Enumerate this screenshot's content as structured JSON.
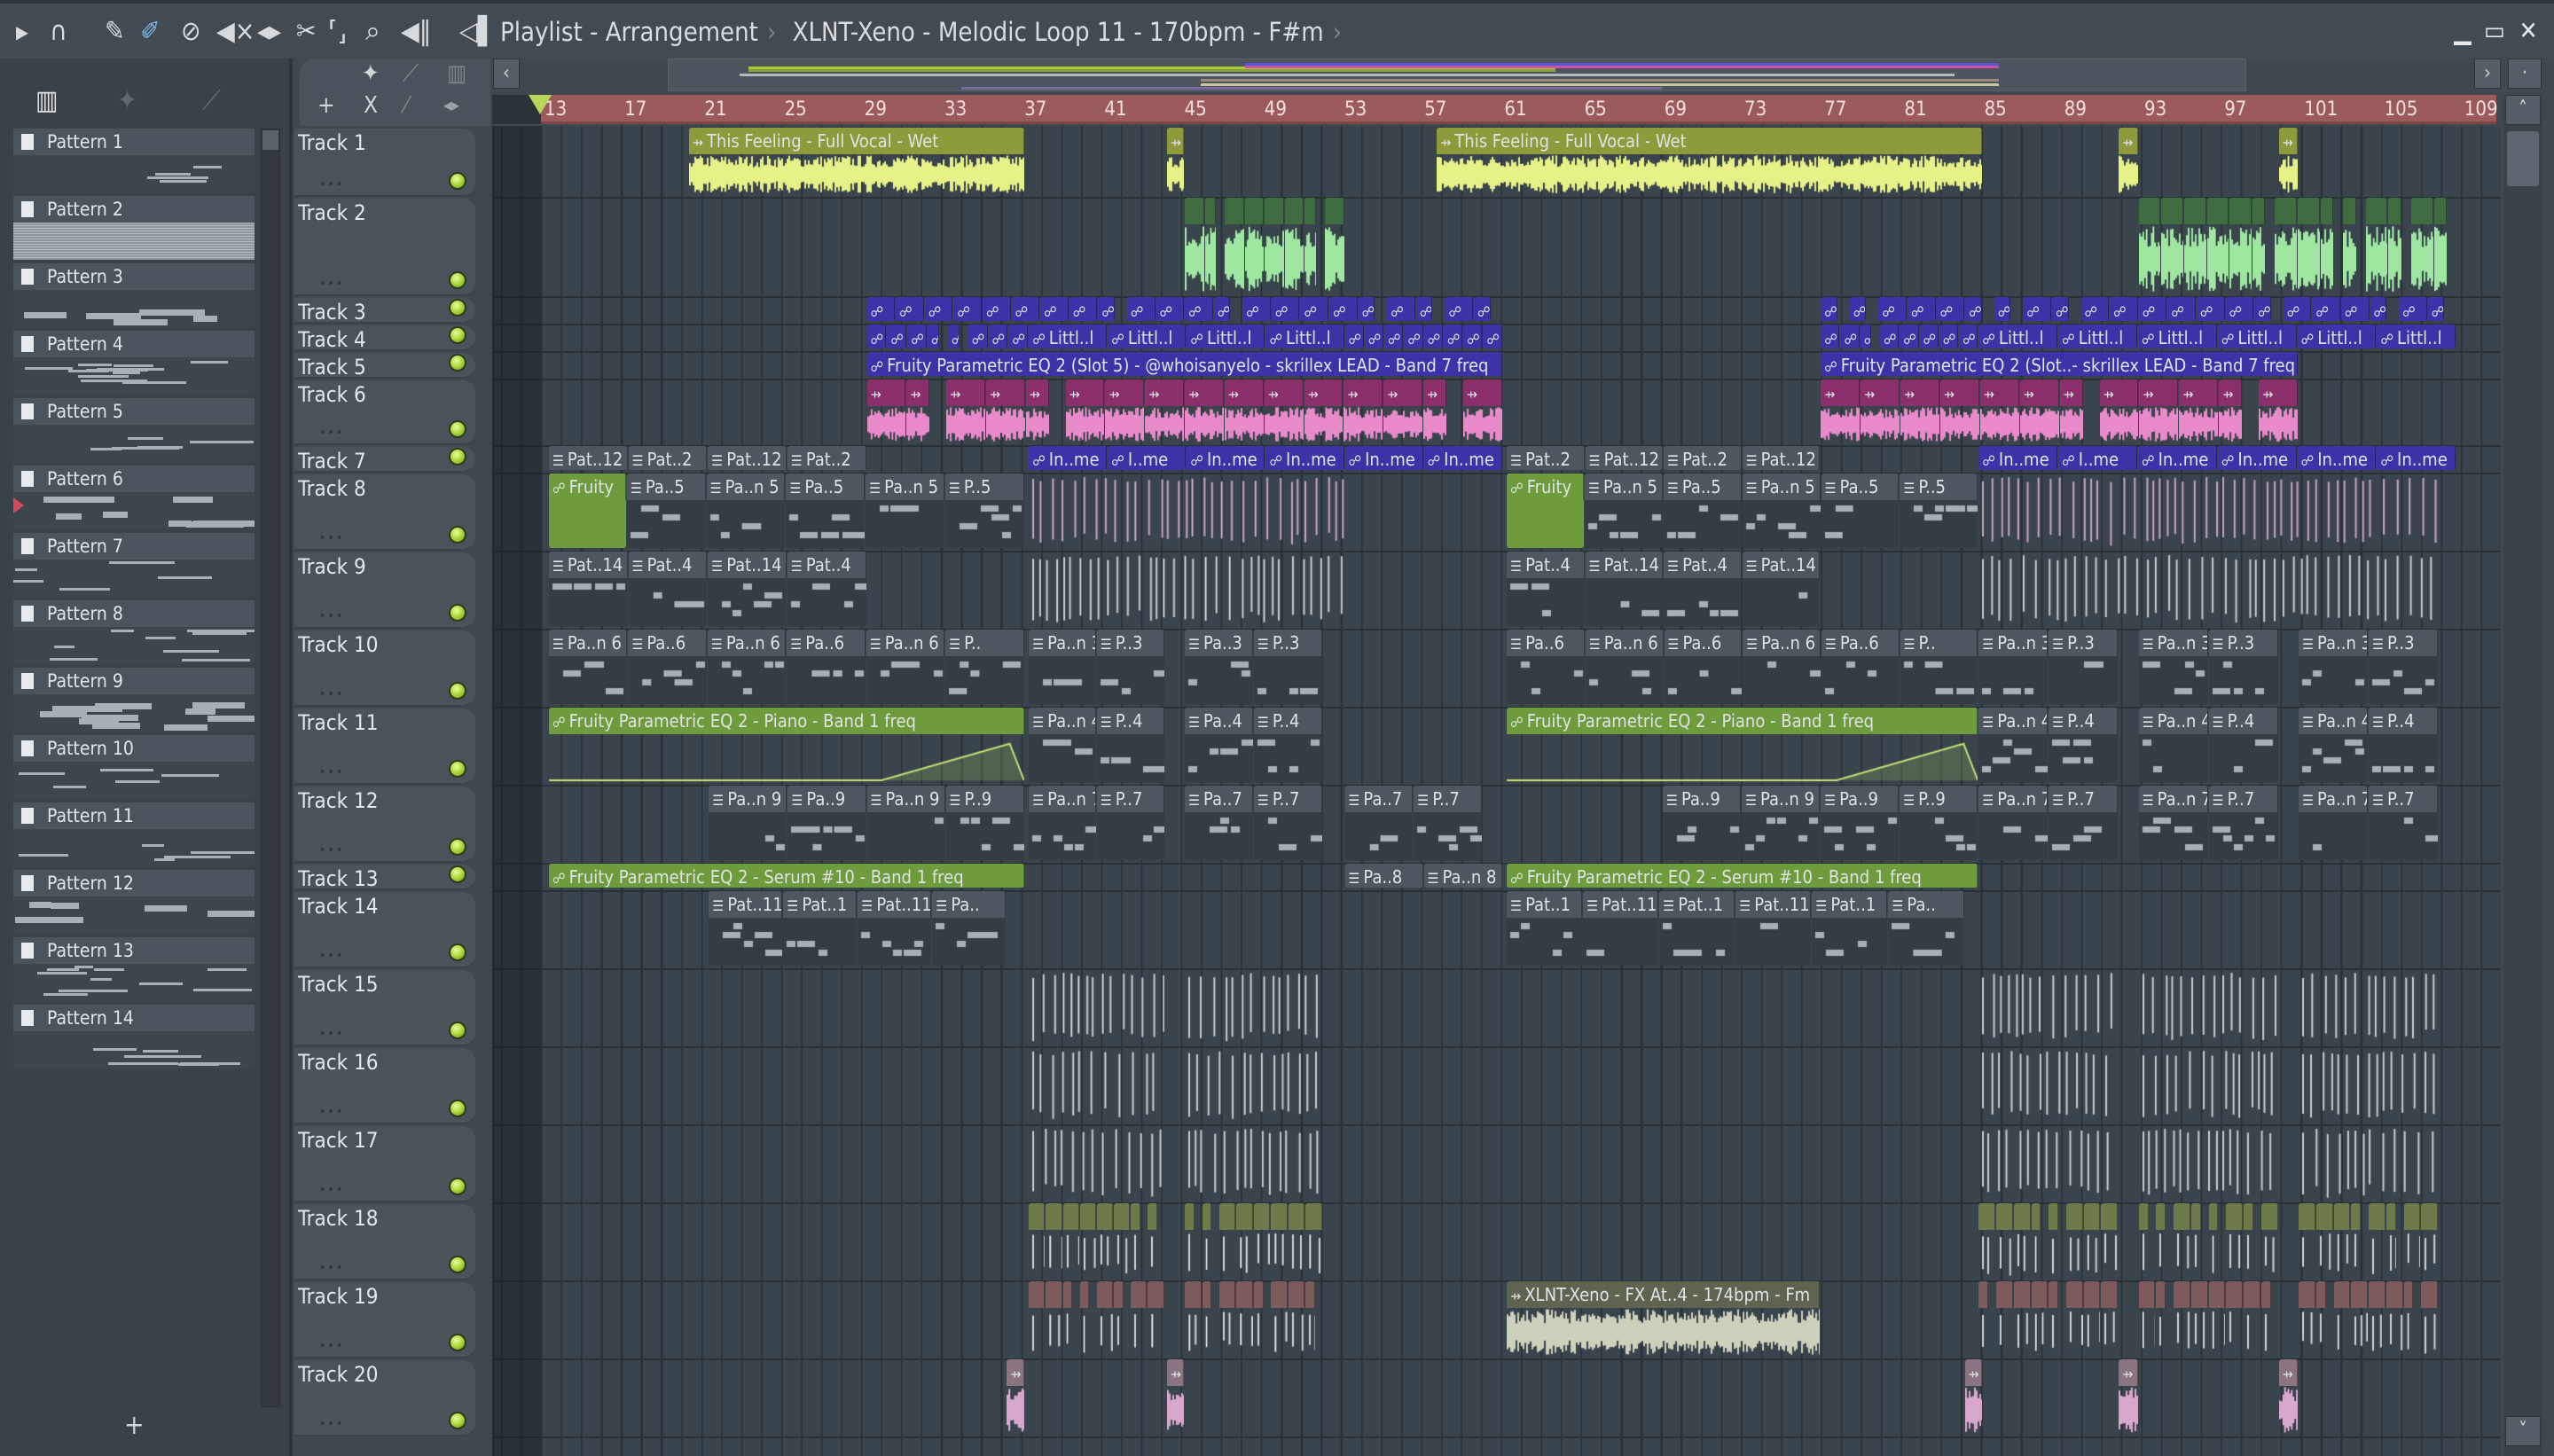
{
  "toolbar": {
    "icons": [
      "play-arrow",
      "magnet",
      "pencil",
      "paint-brush",
      "delete",
      "mute",
      "slip",
      "slice",
      "select",
      "zoom",
      "playback"
    ],
    "title_parts": [
      "Playlist - Arrangement",
      "XLNT-Xeno - Melodic Loop 11 - 170bpm - F#m"
    ]
  },
  "patterns": [
    "Pattern 1",
    "Pattern 2",
    "Pattern 3",
    "Pattern 4",
    "Pattern 5",
    "Pattern 6",
    "Pattern 7",
    "Pattern 8",
    "Pattern 9",
    "Pattern 10",
    "Pattern 11",
    "Pattern 12",
    "Pattern 13",
    "Pattern 14"
  ],
  "add_label": "+",
  "ruler": {
    "bars": [
      "13",
      "17",
      "21",
      "25",
      "29",
      "33",
      "37",
      "41",
      "45",
      "49",
      "53",
      "57",
      "61",
      "65",
      "69",
      "73",
      "77",
      "81",
      "85",
      "89",
      "93",
      "97",
      "101",
      "105",
      "109"
    ]
  },
  "tracks": [
    "Track 1",
    "Track 2",
    "Track 3",
    "Track 4",
    "Track 5",
    "Track 6",
    "Track 7",
    "Track 8",
    "Track 9",
    "Track 10",
    "Track 11",
    "Track 12",
    "Track 13",
    "Track 14",
    "Track 15",
    "Track 16",
    "Track 17",
    "Track 18",
    "Track 19",
    "Track 20"
  ],
  "colors": {
    "ruler": "#9b5a5c",
    "accent": "#b6d85a",
    "brush": "#7ab8ee"
  },
  "clips": [
    {
      "track": 1,
      "start": 20.4,
      "end": 37.2,
      "type": "yellow",
      "labels": [
        "This Feeling - Full Vocal - Wet"
      ]
    },
    {
      "track": 1,
      "start": 44.3,
      "end": 45.2,
      "type": "yellow",
      "labels": []
    },
    {
      "track": 1,
      "start": 57.8,
      "end": 85.1,
      "type": "yellow",
      "labels": [
        "This Feeling - Full Vocal - Wet"
      ]
    },
    {
      "track": 1,
      "start": 91.9,
      "end": 92.9,
      "type": "yellow",
      "labels": []
    },
    {
      "track": 1,
      "start": 99.9,
      "end": 100.9,
      "type": "yellow",
      "labels": []
    },
    {
      "track": 2,
      "start": 45.2,
      "end": 53.2,
      "type": "green",
      "labels": [],
      "segments": 8
    },
    {
      "track": 2,
      "start": 92.9,
      "end": 108.8,
      "type": "green",
      "labels": [],
      "segments": 14
    },
    {
      "track": 3,
      "start": 29.3,
      "end": 61.1,
      "type": "purple",
      "labels": [],
      "segments": 22
    },
    {
      "track": 3,
      "start": 77,
      "end": 108.8,
      "type": "purple",
      "labels": [],
      "segments": 22
    },
    {
      "track": 4,
      "start": 29.3,
      "end": 37.4,
      "type": "purple",
      "labels": [],
      "segments": 8
    },
    {
      "track": 4,
      "start": 37.4,
      "end": 53.2,
      "type": "purple",
      "labels": [
        "Littl..l",
        "Littl..l",
        "Littl..l",
        "Littl..l"
      ]
    },
    {
      "track": 4,
      "start": 53.2,
      "end": 61.1,
      "type": "purple",
      "labels": [],
      "segments": 8
    },
    {
      "track": 4,
      "start": 77,
      "end": 84.9,
      "type": "purple",
      "labels": [],
      "segments": 8
    },
    {
      "track": 4,
      "start": 84.9,
      "end": 108.8,
      "type": "purple",
      "labels": [
        "Littl..l",
        "Littl..l",
        "Littl..l",
        "Littl..l",
        "Littl..l",
        "Littl..l"
      ]
    },
    {
      "track": 5,
      "start": 29.3,
      "end": 61.1,
      "type": "purple-auto",
      "labels": [
        "Fruity Parametric EQ 2 (Slot 5) - @whoisanyelo - skrillex LEAD - Band 7 freq"
      ]
    },
    {
      "track": 5,
      "start": 77,
      "end": 100.9,
      "type": "purple-auto",
      "labels": [
        "Fruity Parametric EQ 2 (Slot..- skrillex LEAD - Band 7 freq"
      ]
    },
    {
      "track": 6,
      "start": 29.3,
      "end": 61.1,
      "type": "pink",
      "labels": [],
      "segments": 16
    },
    {
      "track": 6,
      "start": 77,
      "end": 100.9,
      "type": "pink",
      "labels": [],
      "segments": 12
    },
    {
      "track": 7,
      "start": 13.4,
      "end": 29.3,
      "type": "pattern",
      "labels": [
        "Pat..12",
        "Pat..2",
        "Pat..12",
        "Pat..2"
      ]
    },
    {
      "track": 7,
      "start": 37.4,
      "end": 61.1,
      "type": "purple-auto",
      "labels": [
        "In..me",
        "I..me",
        "In..me",
        "In..me",
        "In..me",
        "In..me"
      ]
    },
    {
      "track": 7,
      "start": 61.3,
      "end": 77,
      "type": "pattern",
      "labels": [
        "Pat..2",
        "Pat..12",
        "Pat..2",
        "Pat..12"
      ]
    },
    {
      "track": 7,
      "start": 84.9,
      "end": 108.8,
      "type": "purple-auto",
      "labels": [
        "In..me",
        "I..me",
        "In..me",
        "In..me",
        "In..me",
        "In..me"
      ]
    },
    {
      "track": 8,
      "start": 13.4,
      "end": 17.3,
      "type": "auto",
      "labels": [
        "Fruity"
      ]
    },
    {
      "track": 8,
      "start": 17.3,
      "end": 37.2,
      "type": "pattern",
      "labels": [
        "Pa..5",
        "Pa..n 5",
        "Pa..5",
        "Pa..n 5",
        "P..5"
      ]
    },
    {
      "track": 8,
      "start": 37.4,
      "end": 53.2,
      "type": "lines-pink",
      "labels": []
    },
    {
      "track": 8,
      "start": 61.3,
      "end": 65.2,
      "type": "auto",
      "labels": [
        "Fruity"
      ]
    },
    {
      "track": 8,
      "start": 65.2,
      "end": 84.9,
      "type": "pattern",
      "labels": [
        "Pa..n 5",
        "Pa..5",
        "Pa..n 5",
        "Pa..5",
        "P..5"
      ]
    },
    {
      "track": 8,
      "start": 84.9,
      "end": 107.9,
      "type": "lines-pink",
      "labels": []
    },
    {
      "track": 9,
      "start": 13.4,
      "end": 29.3,
      "type": "pattern",
      "labels": [
        "Pat..14",
        "Pat..4",
        "Pat..14",
        "Pat..4"
      ]
    },
    {
      "track": 9,
      "start": 37.4,
      "end": 53.2,
      "type": "lines",
      "labels": []
    },
    {
      "track": 9,
      "start": 61.3,
      "end": 77,
      "type": "pattern",
      "labels": [
        "Pat..4",
        "Pat..14",
        "Pat..4",
        "Pat..14"
      ]
    },
    {
      "track": 9,
      "start": 84.9,
      "end": 107.9,
      "type": "lines",
      "labels": []
    },
    {
      "track": 10,
      "start": 13.4,
      "end": 37.2,
      "type": "pattern",
      "labels": [
        "Pa..n 6",
        "Pa..6",
        "Pa..n 6",
        "Pa..6",
        "Pa..n 6",
        "P.."
      ]
    },
    {
      "track": 10,
      "start": 37.4,
      "end": 44.2,
      "type": "pattern",
      "labels": [
        "Pa..n 3",
        "P..3"
      ]
    },
    {
      "track": 10,
      "start": 45.2,
      "end": 52.1,
      "type": "pattern",
      "labels": [
        "Pa..3",
        "P..3"
      ]
    },
    {
      "track": 10,
      "start": 61.3,
      "end": 84.9,
      "type": "pattern",
      "labels": [
        "Pa..6",
        "Pa..n 6",
        "Pa..6",
        "Pa..n 6",
        "Pa..6",
        "P.."
      ]
    },
    {
      "track": 10,
      "start": 84.9,
      "end": 91.9,
      "type": "pattern",
      "labels": [
        "Pa..n 3",
        "P..3"
      ]
    },
    {
      "track": 10,
      "start": 92.9,
      "end": 99.9,
      "type": "pattern",
      "labels": [
        "Pa..n 3",
        "P..3"
      ]
    },
    {
      "track": 10,
      "start": 100.9,
      "end": 107.9,
      "type": "pattern",
      "labels": [
        "Pa..n 3",
        "P..3"
      ]
    },
    {
      "track": 11,
      "start": 13.4,
      "end": 37.2,
      "type": "auto-ramp",
      "labels": [
        "Fruity Parametric EQ 2 - Piano  - Band 1 freq"
      ]
    },
    {
      "track": 11,
      "start": 37.4,
      "end": 44.2,
      "type": "pattern",
      "labels": [
        "Pa..n 4",
        "P..4"
      ]
    },
    {
      "track": 11,
      "start": 45.2,
      "end": 52.1,
      "type": "pattern",
      "labels": [
        "Pa..4",
        "P..4"
      ]
    },
    {
      "track": 11,
      "start": 61.3,
      "end": 84.9,
      "type": "auto-ramp",
      "labels": [
        "Fruity Parametric EQ 2 - Piano  - Band 1 freq"
      ]
    },
    {
      "track": 11,
      "start": 84.9,
      "end": 91.9,
      "type": "pattern",
      "labels": [
        "Pa..n 4",
        "P..4"
      ]
    },
    {
      "track": 11,
      "start": 92.9,
      "end": 99.9,
      "type": "pattern",
      "labels": [
        "Pa..n 4",
        "P..4"
      ]
    },
    {
      "track": 11,
      "start": 100.9,
      "end": 107.9,
      "type": "pattern",
      "labels": [
        "Pa..n 4",
        "P..4"
      ]
    },
    {
      "track": 12,
      "start": 21.4,
      "end": 37.2,
      "type": "pattern",
      "labels": [
        "Pa..n 9",
        "Pa..9",
        "Pa..n 9",
        "P..9"
      ]
    },
    {
      "track": 12,
      "start": 37.4,
      "end": 44.2,
      "type": "pattern",
      "labels": [
        "Pa..n 7",
        "P..7"
      ]
    },
    {
      "track": 12,
      "start": 45.2,
      "end": 52.1,
      "type": "pattern",
      "labels": [
        "Pa..7",
        "P..7"
      ]
    },
    {
      "track": 12,
      "start": 53.2,
      "end": 60.1,
      "type": "pattern",
      "labels": [
        "Pa..7",
        "P..7"
      ]
    },
    {
      "track": 12,
      "start": 69.1,
      "end": 84.9,
      "type": "pattern",
      "labels": [
        "Pa..9",
        "Pa..n 9",
        "Pa..9",
        "P..9"
      ]
    },
    {
      "track": 12,
      "start": 84.9,
      "end": 91.9,
      "type": "pattern",
      "labels": [
        "Pa..n 7",
        "P..7"
      ]
    },
    {
      "track": 12,
      "start": 92.9,
      "end": 99.9,
      "type": "pattern",
      "labels": [
        "Pa..n 7",
        "P..7"
      ]
    },
    {
      "track": 12,
      "start": 100.9,
      "end": 107.9,
      "type": "pattern",
      "labels": [
        "Pa..n 7",
        "P..7"
      ]
    },
    {
      "track": 13,
      "start": 13.4,
      "end": 37.2,
      "type": "auto",
      "labels": [
        "Fruity Parametric EQ 2 - Serum #10 - Band 1 freq"
      ]
    },
    {
      "track": 13,
      "start": 53.2,
      "end": 61.1,
      "type": "pattern",
      "labels": [
        "Pa..8",
        "Pa..n 8"
      ]
    },
    {
      "track": 13,
      "start": 61.3,
      "end": 84.9,
      "type": "auto",
      "labels": [
        "Fruity Parametric EQ 2 - Serum #10 - Band 1 freq"
      ]
    },
    {
      "track": 14,
      "start": 21.4,
      "end": 36.3,
      "type": "pattern",
      "labels": [
        "Pat..11",
        "Pat..1",
        "Pat..11",
        "Pa.."
      ]
    },
    {
      "track": 14,
      "start": 61.3,
      "end": 84.2,
      "type": "pattern",
      "labels": [
        "Pat..1",
        "Pat..11",
        "Pat..1",
        "Pat..11",
        "Pat..1",
        "Pa.."
      ]
    },
    {
      "track": 15,
      "start": 37.4,
      "end": 44.2,
      "type": "lines",
      "labels": []
    },
    {
      "track": 15,
      "start": 45.2,
      "end": 52.1,
      "type": "lines",
      "labels": []
    },
    {
      "track": 15,
      "start": 84.9,
      "end": 91.9,
      "type": "lines",
      "labels": []
    },
    {
      "track": 15,
      "start": 92.9,
      "end": 99.9,
      "type": "lines",
      "labels": []
    },
    {
      "track": 15,
      "start": 100.9,
      "end": 107.9,
      "type": "lines",
      "labels": []
    },
    {
      "track": 16,
      "start": 37.4,
      "end": 44.2,
      "type": "lines",
      "labels": []
    },
    {
      "track": 16,
      "start": 45.2,
      "end": 52.1,
      "type": "lines",
      "labels": []
    },
    {
      "track": 16,
      "start": 84.9,
      "end": 91.9,
      "type": "lines",
      "labels": []
    },
    {
      "track": 16,
      "start": 92.9,
      "end": 99.9,
      "type": "lines",
      "labels": []
    },
    {
      "track": 16,
      "start": 100.9,
      "end": 107.9,
      "type": "lines",
      "labels": []
    },
    {
      "track": 17,
      "start": 37.4,
      "end": 44.2,
      "type": "lines",
      "labels": []
    },
    {
      "track": 17,
      "start": 45.2,
      "end": 52.1,
      "type": "lines",
      "labels": []
    },
    {
      "track": 17,
      "start": 84.9,
      "end": 91.9,
      "type": "lines",
      "labels": []
    },
    {
      "track": 17,
      "start": 92.9,
      "end": 99.9,
      "type": "lines",
      "labels": []
    },
    {
      "track": 17,
      "start": 100.9,
      "end": 107.9,
      "type": "lines",
      "labels": []
    },
    {
      "track": 18,
      "start": 37.4,
      "end": 44.2,
      "type": "olive-small",
      "labels": [],
      "segments": 8
    },
    {
      "track": 18,
      "start": 45.2,
      "end": 52.1,
      "type": "olive-small",
      "labels": [],
      "segments": 8
    },
    {
      "track": 18,
      "start": 84.9,
      "end": 91.9,
      "type": "olive-small",
      "labels": [],
      "segments": 8
    },
    {
      "track": 18,
      "start": 92.9,
      "end": 99.9,
      "type": "olive-small",
      "labels": [],
      "segments": 8
    },
    {
      "track": 18,
      "start": 100.9,
      "end": 107.9,
      "type": "olive-small",
      "labels": [],
      "segments": 8
    },
    {
      "track": 19,
      "start": 37.4,
      "end": 44.2,
      "type": "brown-small",
      "labels": [],
      "segments": 8
    },
    {
      "track": 19,
      "start": 45.2,
      "end": 52.1,
      "type": "brown-small",
      "labels": [],
      "segments": 8
    },
    {
      "track": 19,
      "start": 61.3,
      "end": 77,
      "type": "fx",
      "labels": [
        "XLNT-Xeno - FX At..4 - 174bpm - Fm"
      ]
    },
    {
      "track": 19,
      "start": 84.9,
      "end": 91.9,
      "type": "brown-small",
      "labels": [],
      "segments": 8
    },
    {
      "track": 19,
      "start": 92.9,
      "end": 99.9,
      "type": "brown-small",
      "labels": [],
      "segments": 8
    },
    {
      "track": 19,
      "start": 100.9,
      "end": 107.9,
      "type": "brown-small",
      "labels": [],
      "segments": 8
    },
    {
      "track": 20,
      "start": 36.3,
      "end": 37.2,
      "type": "pinkgrey",
      "labels": []
    },
    {
      "track": 20,
      "start": 44.3,
      "end": 45.2,
      "type": "pinkgrey",
      "labels": []
    },
    {
      "track": 20,
      "start": 84.2,
      "end": 85.1,
      "type": "pinkgrey",
      "labels": []
    },
    {
      "track": 20,
      "start": 91.9,
      "end": 92.9,
      "type": "pinkgrey",
      "labels": []
    },
    {
      "track": 20,
      "start": 99.9,
      "end": 100.9,
      "type": "pinkgrey",
      "labels": []
    }
  ]
}
